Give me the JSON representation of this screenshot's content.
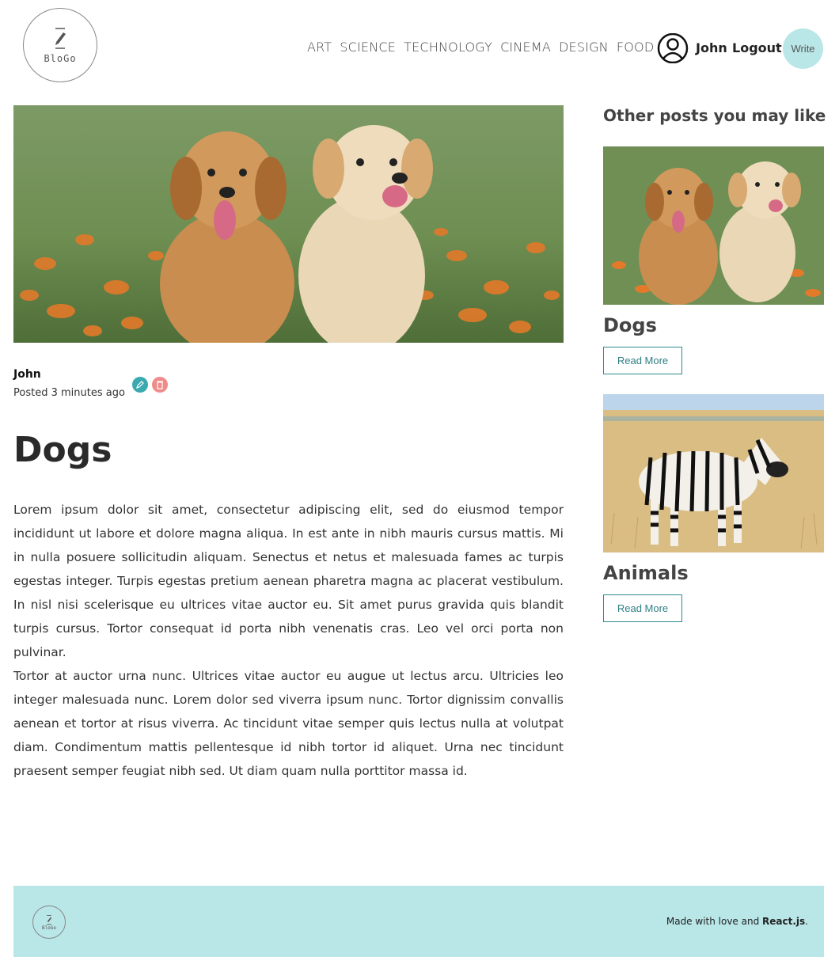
{
  "header": {
    "logo_text": "BloGo",
    "nav": [
      "ART",
      "SCIENCE",
      "TECHNOLOGY",
      "CINEMA",
      "DESIGN",
      "FOOD"
    ],
    "user_name": "John",
    "logout_label": "Logout",
    "write_label": "Write"
  },
  "post": {
    "author": "John",
    "posted": "Posted 3 minutes ago",
    "title": "Dogs",
    "paragraphs": [
      "Lorem ipsum dolor sit amet, consectetur adipiscing elit, sed do eiusmod tempor incididunt ut labore et dolore magna aliqua. In est ante in nibh mauris cursus mattis. Mi in nulla posuere sollicitudin aliquam. Senectus et netus et malesuada fames ac turpis egestas integer. Turpis egestas pretium aenean pharetra magna ac placerat vestibulum. In nisl nisi scelerisque eu ultrices vitae auctor eu. Sit amet purus gravida quis blandit turpis cursus. Tortor consequat id porta nibh venenatis cras. Leo vel orci porta non pulvinar.",
      "Tortor at auctor urna nunc. Ultrices vitae auctor eu augue ut lectus arcu. Ultricies leo integer malesuada nunc. Lorem dolor sed viverra ipsum nunc. Tortor dignissim convallis aenean et tortor at risus viverra. Ac tincidunt vitae semper quis lectus nulla at volutpat diam. Condimentum mattis pellentesque id nibh tortor id aliquet. Urna nec tincidunt praesent semper feugiat nibh sed. Ut diam quam nulla porttitor massa id."
    ]
  },
  "sidebar": {
    "heading": "Other posts you may like",
    "posts": [
      {
        "title": "Dogs",
        "button": "Read More"
      },
      {
        "title": "Animals",
        "button": "Read More"
      }
    ]
  },
  "footer": {
    "logo_text": "BloGo",
    "text_prefix": "Made with love and ",
    "text_bold": "React.js",
    "text_suffix": "."
  },
  "colors": {
    "accent": "#b9e6e7",
    "edit": "#3aaab0",
    "delete": "#f08b8b",
    "button_border": "#2f8a8f"
  }
}
